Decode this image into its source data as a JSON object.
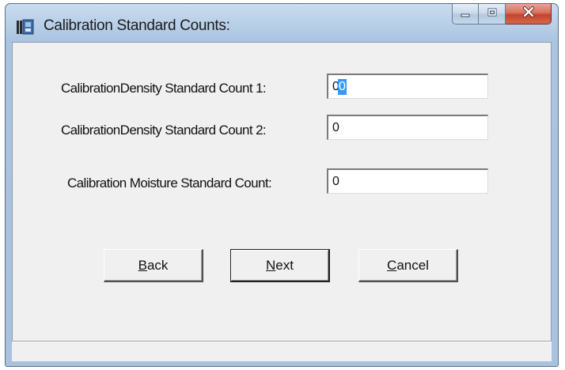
{
  "window": {
    "title": "Calibration Standard Counts:",
    "icon": "app-icon"
  },
  "caption": {
    "minimize_icon": "minimize-icon",
    "maximize_icon": "maximize-icon",
    "close_icon": "close-icon",
    "close_color": "#c2452c"
  },
  "form": {
    "density1": {
      "label": "CalibrationDensity Standard Count 1:",
      "value": "0",
      "selected": true
    },
    "density2": {
      "label": "CalibrationDensity Standard Count 2:",
      "value": "0"
    },
    "moisture": {
      "label": "Calibration Moisture Standard Count:",
      "value": "0"
    }
  },
  "buttons": {
    "back": {
      "mnemonic": "B",
      "rest": "ack"
    },
    "next": {
      "mnemonic": "N",
      "rest": "ext"
    },
    "cancel": {
      "mnemonic": "C",
      "rest": "ancel"
    }
  },
  "colors": {
    "selection": "#3399ff",
    "frame": "#aac3df",
    "client": "#f0f0f0"
  }
}
